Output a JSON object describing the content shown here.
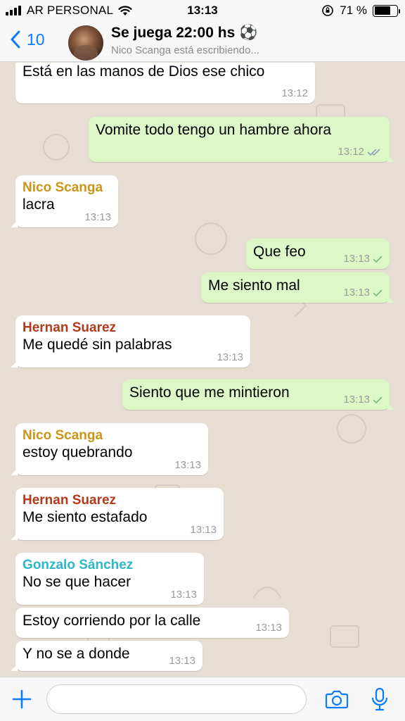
{
  "status_bar": {
    "carrier": "AR PERSONAL",
    "time": "13:13",
    "battery_percent": "71 %",
    "battery_level": 0.71
  },
  "header": {
    "back_count": "10",
    "title": "Se juega 22:00 hs ⚽️",
    "subtitle": "Nico Scanga está escribiendo..."
  },
  "colors": {
    "accent": "#0a7cff",
    "outgoing_bubble": "#dcf8c6",
    "incoming_bubble": "#ffffff",
    "chat_background": "#e6ddd3",
    "read_ticks": "#8aa5b8",
    "sent_tick": "#7fb97f",
    "sender_nico": "#c8951a",
    "sender_hernan": "#b5391b",
    "sender_gonzalo": "#2fb7c9"
  },
  "messages": [
    {
      "direction": "in",
      "sender": "",
      "text": "Está en las manos de Dios ese chico",
      "time": "13:12"
    },
    {
      "direction": "out",
      "text": "Vomite todo tengo un hambre ahora",
      "time": "13:12",
      "status": "read"
    },
    {
      "direction": "in",
      "sender": "Nico Scanga",
      "text": "lacra",
      "time": "13:13"
    },
    {
      "direction": "out",
      "text": "Que feo",
      "time": "13:13",
      "status": "sent"
    },
    {
      "direction": "out",
      "text": "Me siento mal",
      "time": "13:13",
      "status": "sent"
    },
    {
      "direction": "in",
      "sender": "Hernan Suarez",
      "text": "Me quedé sin palabras",
      "time": "13:13"
    },
    {
      "direction": "out",
      "text": "Siento que me mintieron",
      "time": "13:13",
      "status": "sent"
    },
    {
      "direction": "in",
      "sender": "Nico Scanga",
      "text": "estoy quebrando",
      "time": "13:13"
    },
    {
      "direction": "in",
      "sender": "Hernan Suarez",
      "text": "Me siento estafado",
      "time": "13:13"
    },
    {
      "direction": "in",
      "sender": "Gonzalo Sánchez",
      "text": "No se que hacer",
      "time": "13:13"
    },
    {
      "direction": "in",
      "sender": "",
      "text": "Estoy corriendo por la calle",
      "time": "13:13"
    },
    {
      "direction": "in",
      "sender": "",
      "text": "Y no se a donde",
      "time": "13:13"
    }
  ],
  "input_bar": {
    "placeholder": "",
    "icons": [
      "plus-icon",
      "camera-icon",
      "microphone-icon"
    ]
  }
}
